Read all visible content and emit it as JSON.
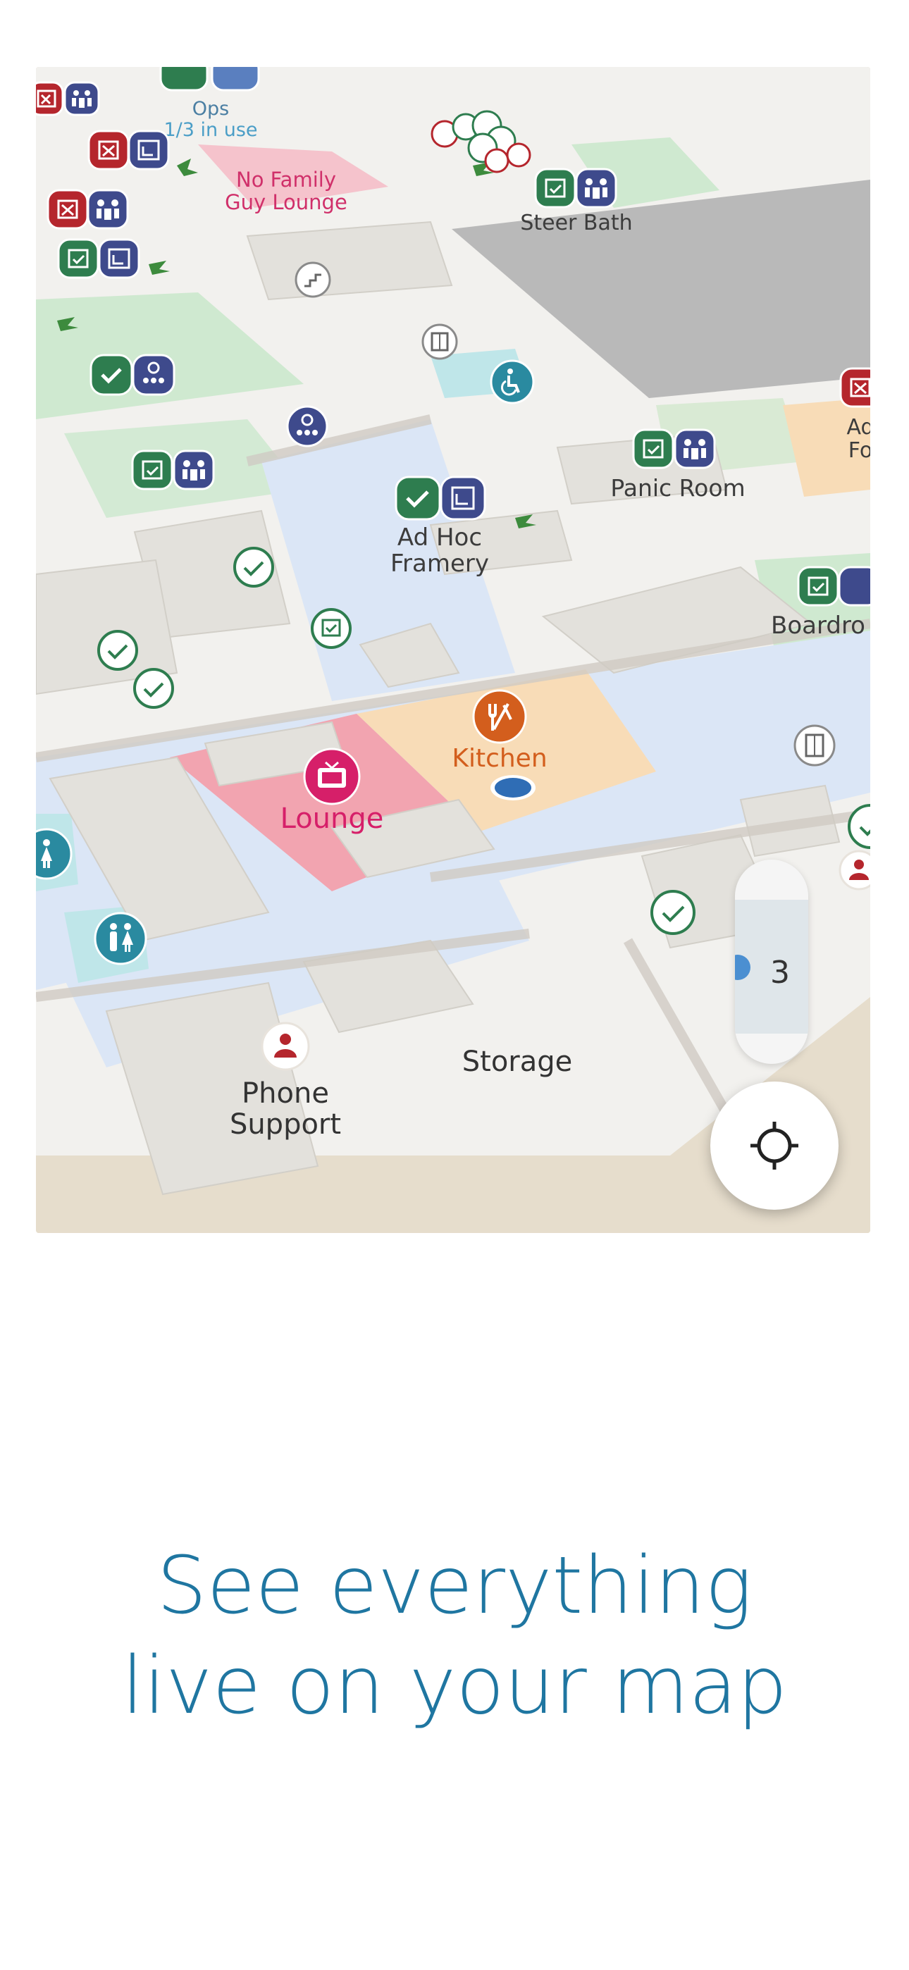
{
  "map": {
    "rooms": {
      "ops": "Ops",
      "ops_status": "1/3 in use",
      "no_family_guy_lounge_1": "No Family",
      "no_family_guy_lounge_2": "Guy Lounge",
      "steer_bath": "Steer Bath",
      "panic_room": "Panic Room",
      "ad_hoc_framery_1": "Ad Hoc",
      "ad_hoc_framery_2": "Framery",
      "boardroom_partial": "Boardro",
      "ad_partial_1": "Ad",
      "ad_partial_2": "Fo",
      "kitchen": "Kitchen",
      "lounge": "Lounge",
      "phone_support_1": "Phone",
      "phone_support_2": "Support",
      "storage": "Storage"
    },
    "colors": {
      "available": "#2e7d4f",
      "booked": "#b5262d",
      "capacity": "#3e4a8c",
      "kitchen": "#d35e1d",
      "lounge": "#d61f69",
      "accessibility": "#2a8aa0",
      "corridor": "#dbe6f6"
    },
    "floor_selector": {
      "current_floor": "3"
    },
    "locate_button": {
      "icon": "crosshair-icon"
    }
  },
  "headline": {
    "line1": "See everything",
    "line2": "live on your map"
  }
}
